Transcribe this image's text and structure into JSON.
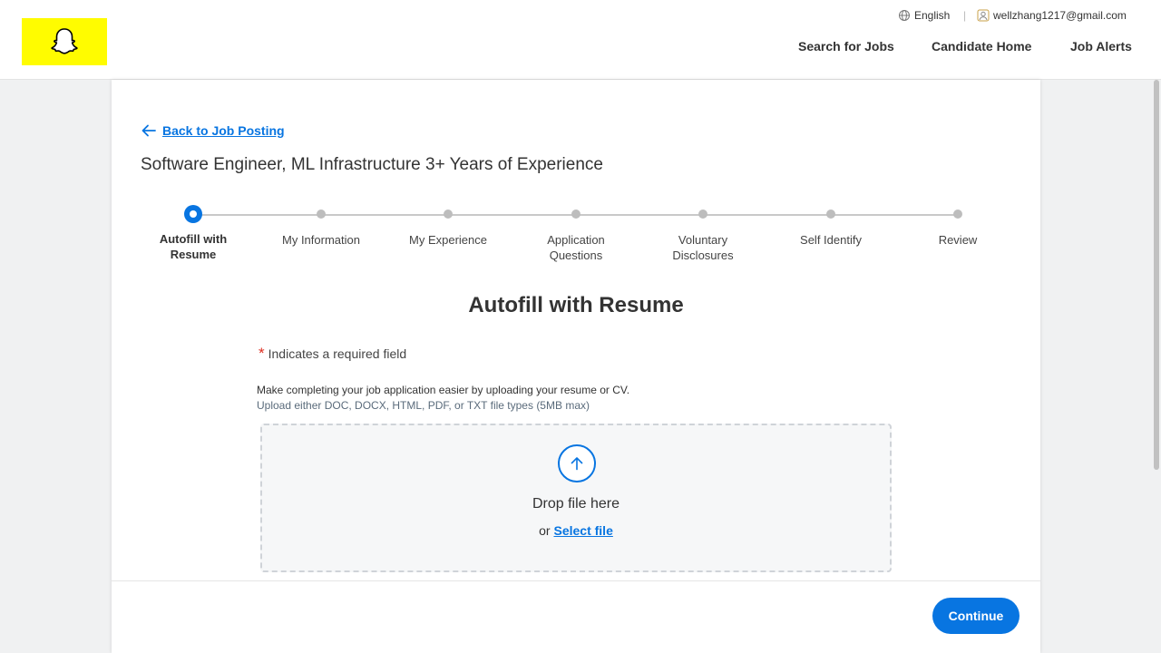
{
  "header": {
    "logo_name": "snapchat-ghost-logo",
    "language": "English",
    "user_email": "wellzhang1217@gmail.com",
    "separator": "|",
    "nav": {
      "search_jobs": "Search for Jobs",
      "candidate_home": "Candidate Home",
      "job_alerts": "Job Alerts"
    }
  },
  "page": {
    "back_link": "Back to Job Posting",
    "job_title": "Software Engineer, ML Infrastructure 3+ Years of Experience"
  },
  "stepper": {
    "current_index": 0,
    "steps": [
      {
        "label": "Autofill with Resume"
      },
      {
        "label": "My Information"
      },
      {
        "label": "My Experience"
      },
      {
        "label": "Application Questions"
      },
      {
        "label": "Voluntary Disclosures"
      },
      {
        "label": "Self Identify"
      },
      {
        "label": "Review"
      }
    ]
  },
  "form": {
    "section_title": "Autofill with Resume",
    "required_star": "*",
    "required_note": "Indicates a required field",
    "description": "Make completing your job application easier by uploading your resume or CV.",
    "file_types": "Upload either DOC, DOCX, HTML, PDF, or TXT file types (5MB max)",
    "drop_text": "Drop file here",
    "or_text": "or",
    "select_file": "Select file"
  },
  "footer": {
    "continue_label": "Continue"
  },
  "colors": {
    "accent": "#0875e1",
    "logo_bg": "#fffc00",
    "required": "#de2e21"
  }
}
